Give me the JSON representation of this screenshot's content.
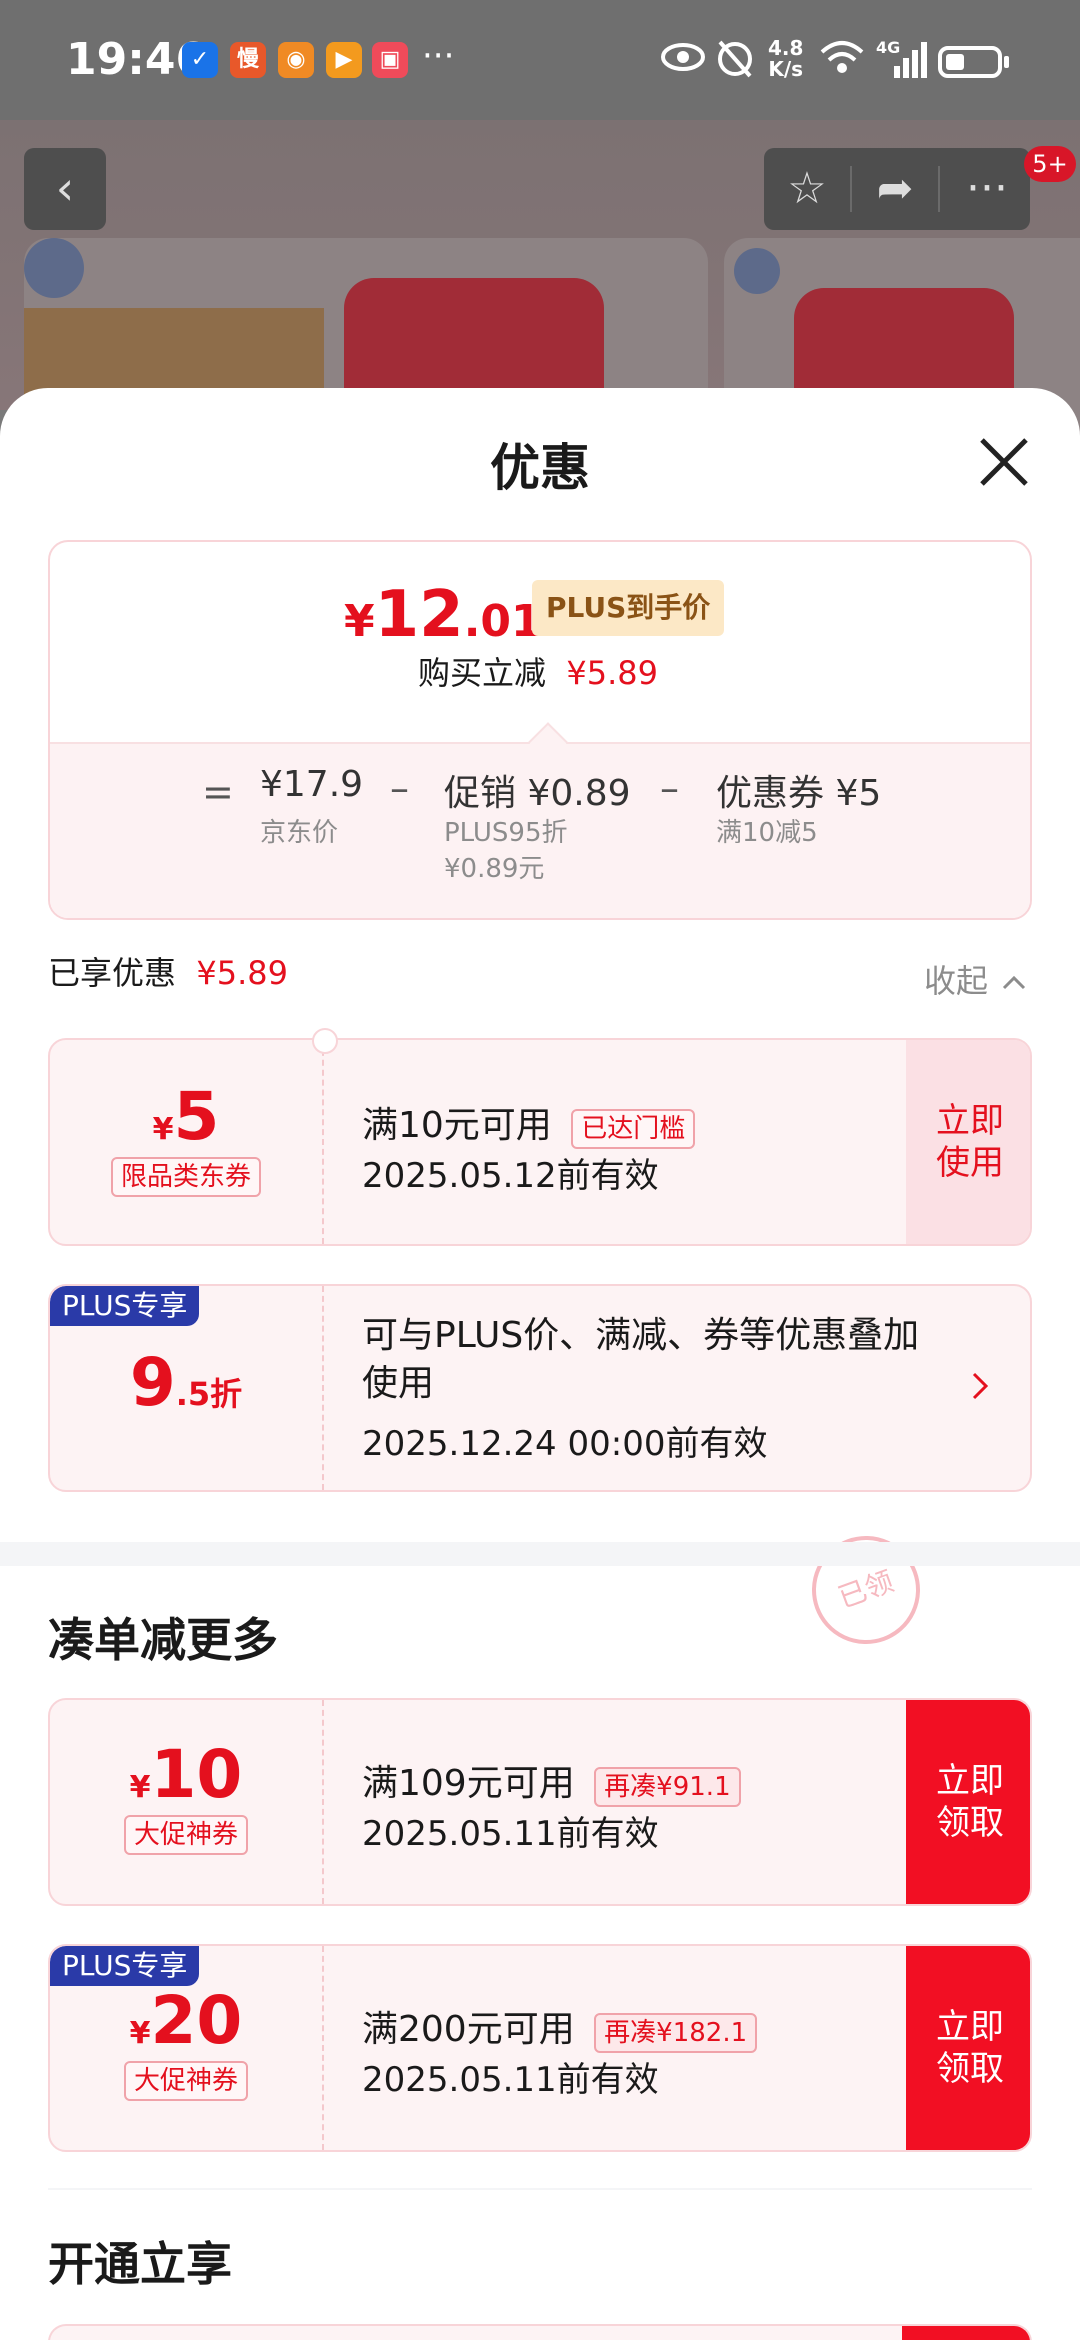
{
  "status_bar": {
    "time": "19:46",
    "dots": "···",
    "speed_top": "4.8",
    "speed_bottom": "K/s",
    "network": "4G"
  },
  "background": {
    "more_badge": "5+"
  },
  "sheet": {
    "title": "优惠",
    "price": {
      "currency": "¥",
      "integer": "12",
      "decimal": ".01",
      "plus_label": "PLUS到手价",
      "reduce_label": "购买立减",
      "reduce_value": "¥5.89",
      "eq": "=",
      "minus": "–",
      "jd_value": "¥17.9",
      "jd_label": "京东价",
      "promo_title": "促销 ¥0.89",
      "promo_sub1": "PLUS95折",
      "promo_sub2": "¥0.89元",
      "coupon_title": "优惠券 ¥5",
      "coupon_sub": "满10减5"
    },
    "enjoyed": {
      "label": "已享优惠",
      "value": "¥5.89",
      "collapse": "收起"
    },
    "coupons_enjoyed": [
      {
        "currency": "¥",
        "amount": "5",
        "tag": "限品类东券",
        "condition": "满10元可用",
        "status": "已达门槛",
        "validity": "2025.05.12前有效",
        "cta": "立即使用",
        "stamp": "已领"
      },
      {
        "corner": "PLUS专享",
        "amount": "9",
        "amount_suffix": ".5折",
        "condition": "可与PLUS价、满减、券等优惠叠加使用",
        "validity": "2025.12.24 00:00前有效"
      }
    ],
    "section_more": "凑单减更多",
    "coupons_more": [
      {
        "currency": "¥",
        "amount": "10",
        "tag": "大促神券",
        "condition": "满109元可用",
        "status": "再凑¥91.1",
        "validity": "2025.05.11前有效",
        "cta": "立即领取"
      },
      {
        "corner": "PLUS专享",
        "currency": "¥",
        "amount": "20",
        "tag": "大促神券",
        "condition": "满200元可用",
        "status": "再凑¥182.1",
        "validity": "2025.05.11前有效",
        "cta": "立即领取"
      }
    ],
    "section_open": "开通立享"
  }
}
